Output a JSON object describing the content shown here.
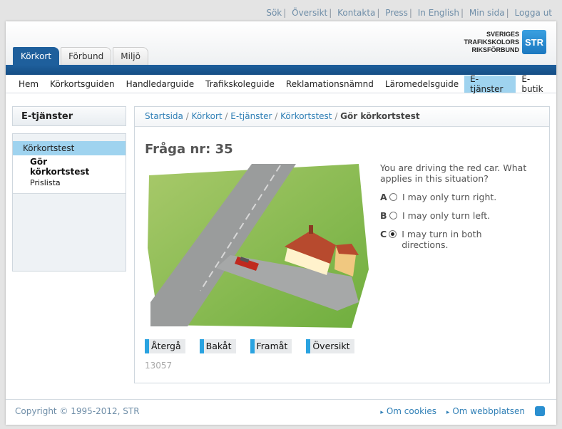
{
  "top_links": [
    "Sök",
    "Översikt",
    "Kontakta",
    "Press",
    "In English",
    "Min sida",
    "Logga ut"
  ],
  "logo": {
    "line1": "SVERIGES",
    "line2": "TRAFIKSKOLORS",
    "line3": "RIKSFÖRBUND",
    "mark": "STR"
  },
  "tabs": [
    {
      "label": "Körkort",
      "active": true
    },
    {
      "label": "Förbund"
    },
    {
      "label": "Miljö"
    }
  ],
  "nav": [
    {
      "label": "Hem"
    },
    {
      "label": "Körkortsguiden"
    },
    {
      "label": "Handledarguide"
    },
    {
      "label": "Trafikskoleguide"
    },
    {
      "label": "Reklamationsnämnd"
    },
    {
      "label": "Läromedelsguide"
    },
    {
      "label": "E-tjänster",
      "active": true
    },
    {
      "label": "E-butik"
    }
  ],
  "sidebar": {
    "title": "E-tjänster",
    "section": "Körkortstest",
    "items": [
      "Gör körkortstest",
      "Prislista"
    ]
  },
  "breadcrumb": [
    "Startsida",
    "Körkort",
    "E-tjänster",
    "Körkortstest",
    "Gör körkortstest"
  ],
  "question": {
    "title": "Fråga nr: 35",
    "text": "You are driving the red car. What applies in this situation?",
    "options": [
      {
        "letter": "A",
        "text": "I may only turn right.",
        "checked": false
      },
      {
        "letter": "B",
        "text": "I may only turn left.",
        "checked": false
      },
      {
        "letter": "C",
        "text": "I may turn in both directions.",
        "checked": true
      }
    ]
  },
  "buttons": [
    "Återgå",
    "Bakåt",
    "Framåt",
    "Översikt"
  ],
  "code": "13057",
  "footer": {
    "copyright": "Copyright © 1995-2012, STR",
    "links": [
      "Om cookies",
      "Om webbplatsen"
    ]
  }
}
